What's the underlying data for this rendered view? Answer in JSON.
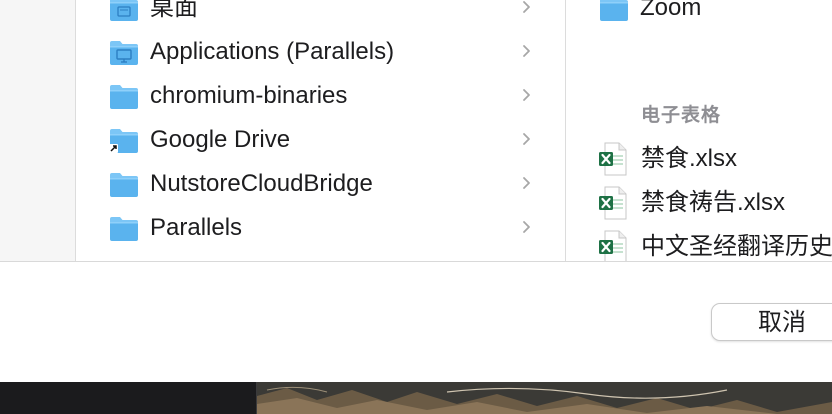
{
  "column1": {
    "items": [
      {
        "label": "桌面",
        "icon": "desktop-folder-icon"
      },
      {
        "label": "Applications (Parallels)",
        "icon": "applications-folder-icon"
      },
      {
        "label": "chromium-binaries",
        "icon": "folder-icon"
      },
      {
        "label": "Google Drive",
        "icon": "alias-folder-icon"
      },
      {
        "label": "NutstoreCloudBridge",
        "icon": "folder-icon"
      },
      {
        "label": "Parallels",
        "icon": "folder-icon"
      }
    ]
  },
  "column2": {
    "zoom_label": "Zoom",
    "section_header": "电子表格",
    "files": [
      {
        "label": "禁食.xlsx",
        "icon": "excel-file-icon"
      },
      {
        "label": "禁食祷告.xlsx",
        "icon": "excel-file-icon"
      },
      {
        "label": "中文圣经翻译历史",
        "icon": "excel-file-icon"
      }
    ]
  },
  "dialog": {
    "cancel_label": "取消"
  },
  "colors": {
    "folder_blue": "#5ab3ee",
    "folder_tab": "#7cc6f6",
    "excel_green": "#1e7145",
    "section_gray": "#8e8e93"
  }
}
